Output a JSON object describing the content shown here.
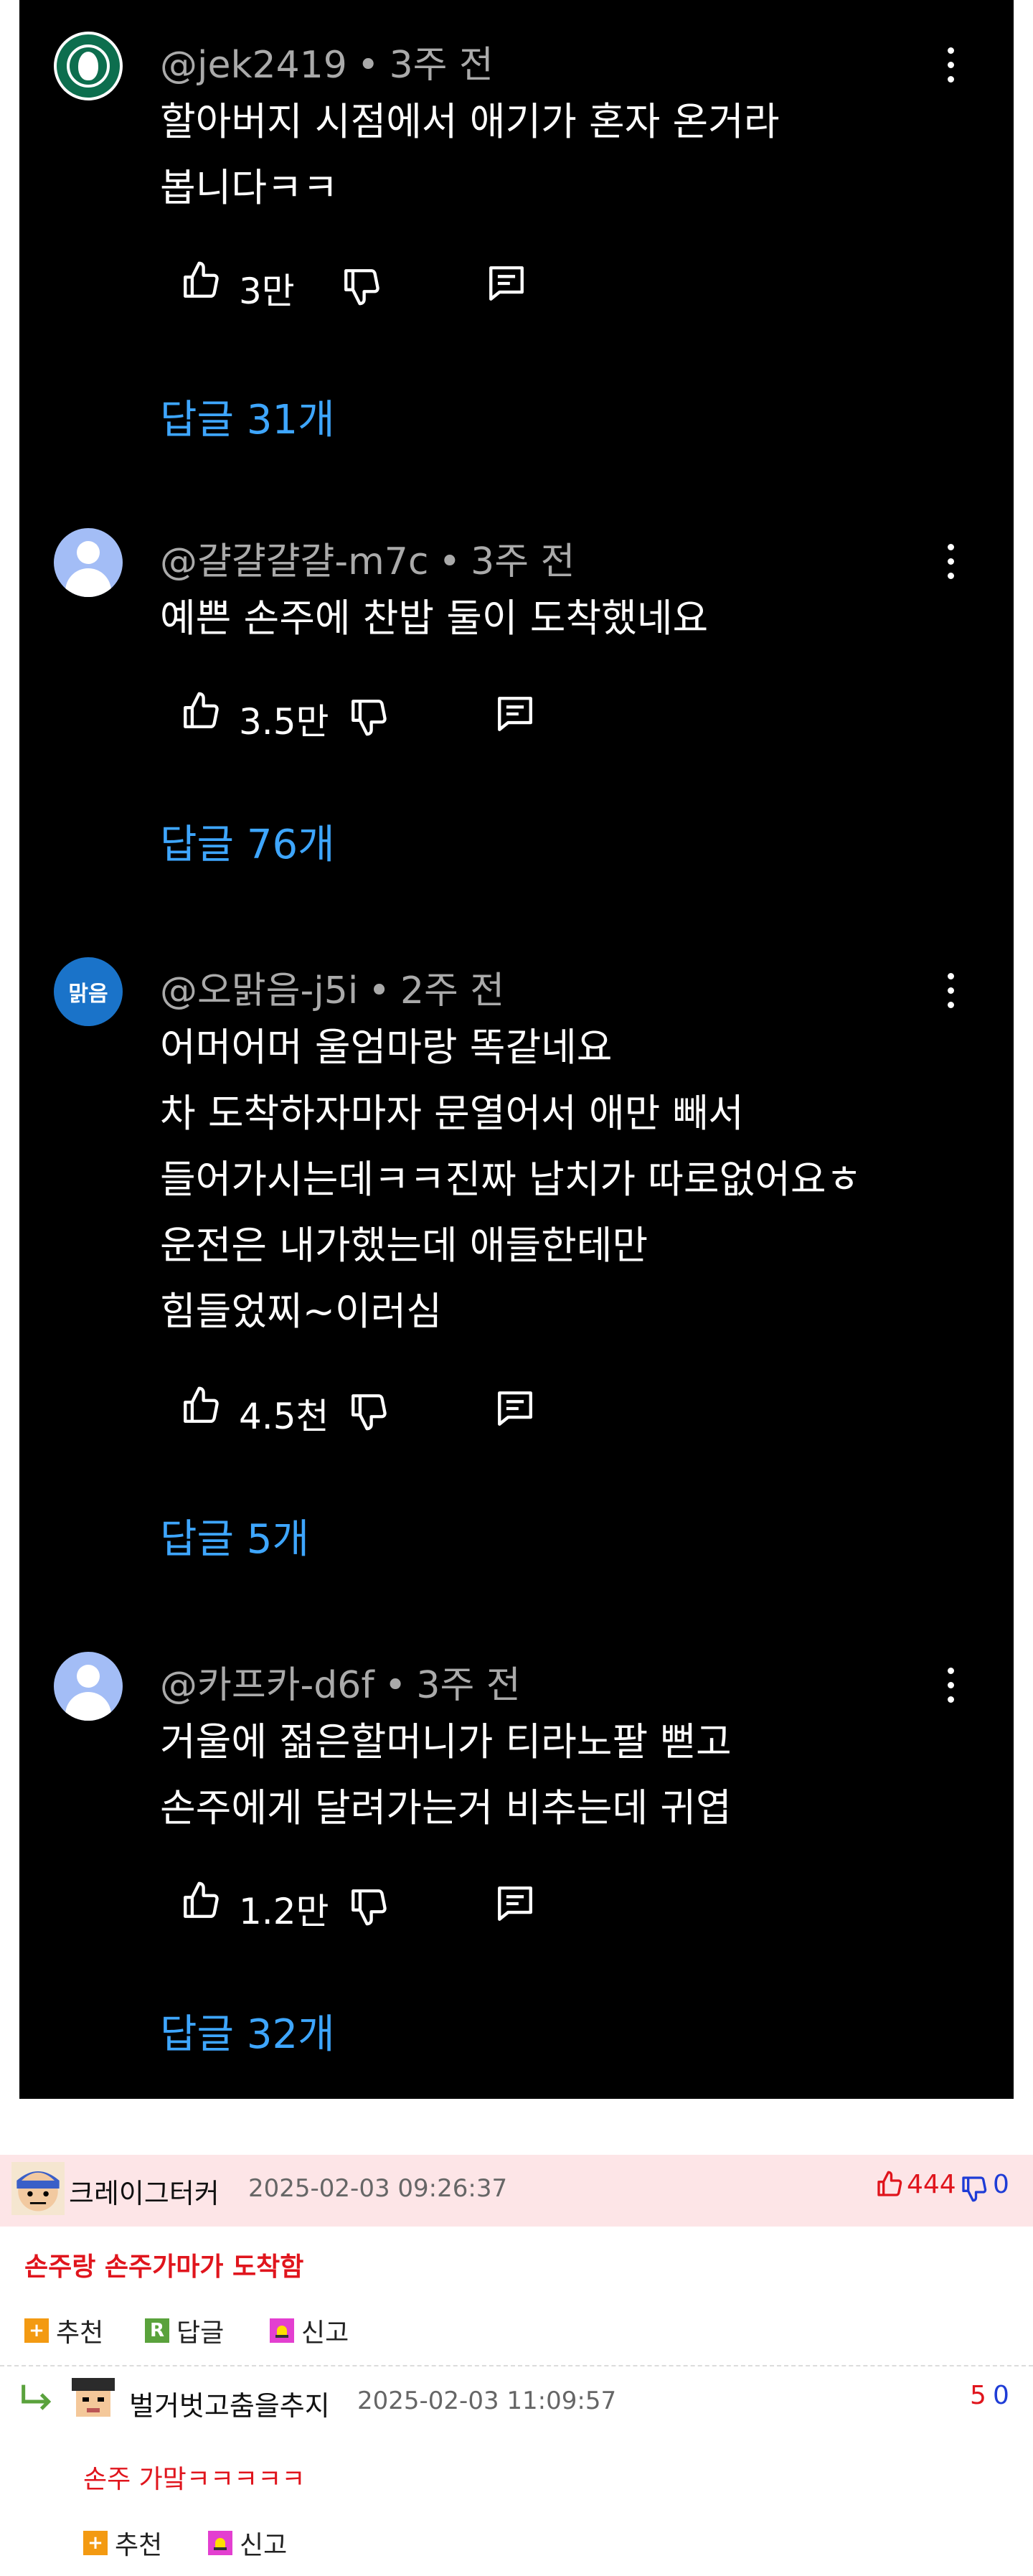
{
  "comments": [
    {
      "author": "@jek2419",
      "time": "3주 전",
      "lines": [
        "할아버지 시점에서 애기가 혼자 온거라",
        "봅니다ㅋㅋ"
      ],
      "likes": "3만",
      "replies": "답글 31개",
      "avatar": "starbucks-logo"
    },
    {
      "author": "@걀걀걀걀-m7c",
      "time": "3주 전",
      "lines": [
        "예쁜 손주에 찬밥 둘이 도착했네요"
      ],
      "likes": "3.5만",
      "replies": "답글 76개",
      "avatar": "default-person"
    },
    {
      "author": "@오맑음-j5i",
      "time": "2주 전",
      "lines": [
        "어머어머 울엄마랑 똑같네요",
        "차 도착하자마자 문열어서 애만 빼서",
        "들어가시는데ㅋㅋ진짜 납치가 따로없어요ㅎ",
        "운전은 내가했는데 애들한테만",
        "힘들었찌~이러심"
      ],
      "likes": "4.5천",
      "replies": "답글 5개",
      "avatar_text": "맑음"
    },
    {
      "author": "@카프카-d6f",
      "time": "3주 전",
      "lines": [
        "거울에 젊은할머니가 티라노팔 뻗고",
        "손주에게 달려가는거 비추는데 귀엽"
      ],
      "likes": "1.2만",
      "replies": "답글 32개",
      "avatar": "default-person"
    }
  ],
  "community": {
    "post": {
      "user": "크레이그터커",
      "date": "2025-02-03 09:26:37",
      "up": "444",
      "down": "0",
      "body": "손주랑 손주가마가 도착함",
      "actions": {
        "recommend": "추천",
        "reply": "답글",
        "report": "신고"
      }
    },
    "reply": {
      "user": "벌거벗고춤을추지",
      "date": "2025-02-03 11:09:57",
      "up": "5",
      "down": "0",
      "body": "손주 가맠ㅋㅋㅋㅋㅋ",
      "actions": {
        "recommend": "추천",
        "report": "신고"
      }
    }
  },
  "colors": {
    "background": "#000000",
    "reply_link": "#3ea6ff",
    "meta": "#aaaaaa",
    "red": "#e0151d",
    "blue": "#1e3cd6",
    "band": "#fde5e7"
  }
}
